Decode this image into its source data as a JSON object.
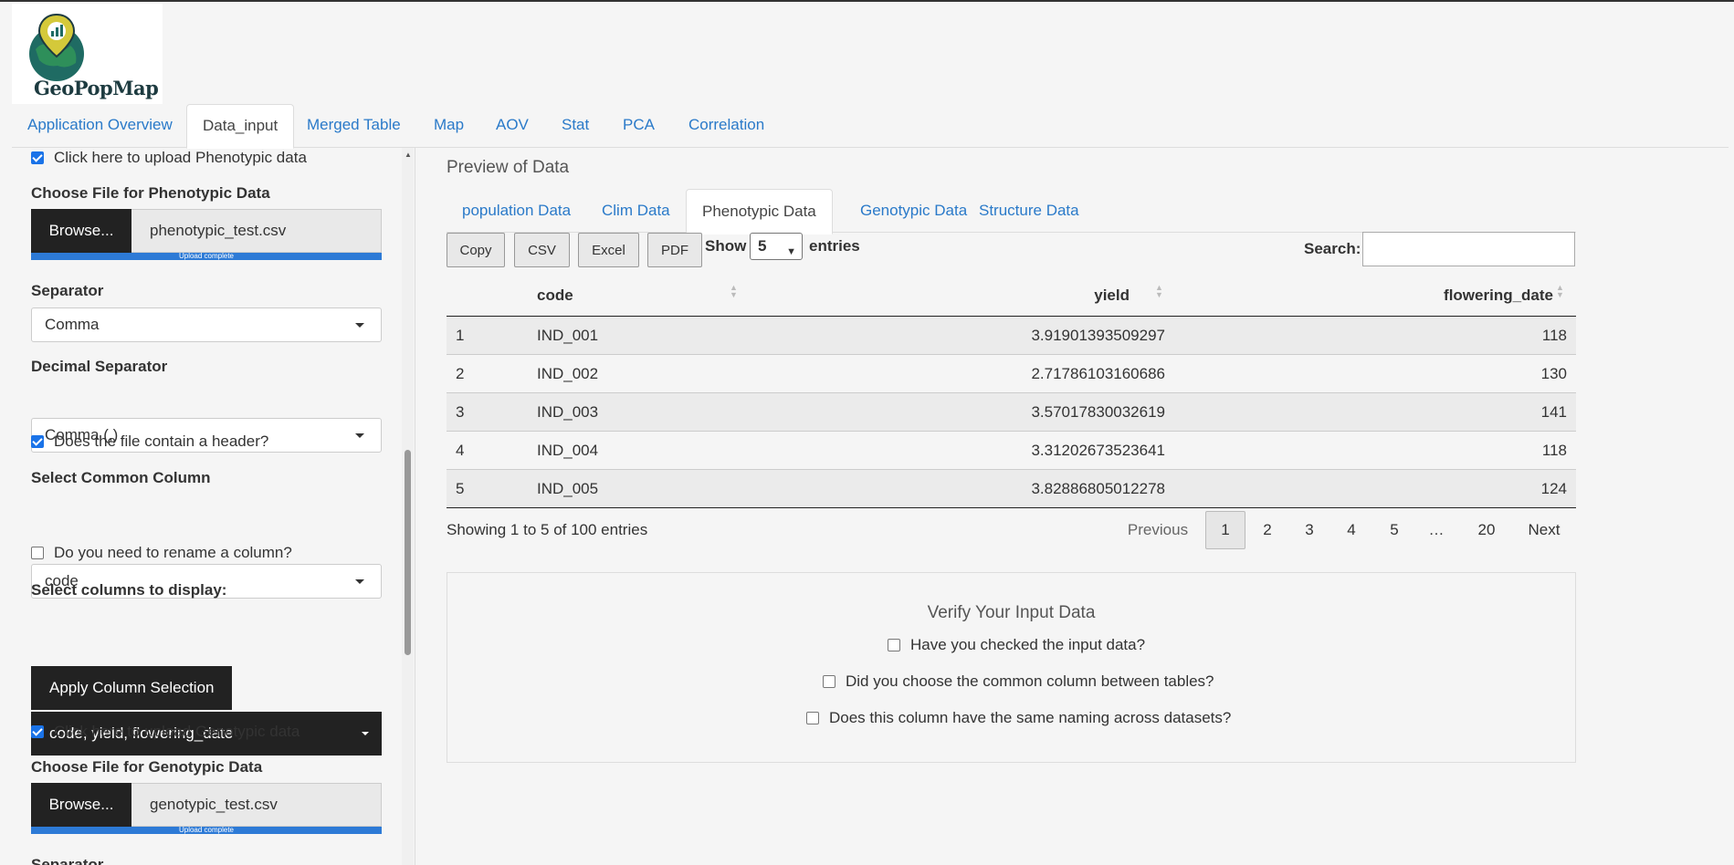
{
  "app": {
    "logo_text": "GeoPopMap"
  },
  "navbar": {
    "tabs": [
      {
        "label": "Application Overview"
      },
      {
        "label": "Data_input",
        "active": true
      },
      {
        "label": "Merged Table"
      },
      {
        "label": "Map"
      },
      {
        "label": "AOV"
      },
      {
        "label": "Stat"
      },
      {
        "label": "PCA"
      },
      {
        "label": "Correlation"
      }
    ]
  },
  "sidebar": {
    "upload_pheno": {
      "label": "Click here to upload Phenotypic data",
      "checked": true
    },
    "pheno_file_label": "Choose File for Phenotypic Data",
    "pheno_browse": "Browse...",
    "pheno_filename": "phenotypic_test.csv",
    "pheno_progress": "Upload complete",
    "separator_label": "Separator",
    "separator_value": "Comma",
    "decimal_label": "Decimal Separator",
    "decimal_value": "Comma (,)",
    "header_check": {
      "label": "Does the file contain a header?",
      "checked": true
    },
    "common_col_label": "Select Common Column",
    "common_col_value": "code",
    "rename_check": {
      "label": "Do you need to rename a column?",
      "checked": false
    },
    "display_cols_label": "Select columns to display:",
    "display_cols_value": "code, yield, flowering_date",
    "apply_button": "Apply Column Selection",
    "upload_geno": {
      "label": "Click here to upload Genotypic data",
      "checked": true
    },
    "geno_file_label": "Choose File for Genotypic Data",
    "geno_browse": "Browse...",
    "geno_filename": "genotypic_test.csv",
    "geno_progress": "Upload complete",
    "separator2_label": "Separator"
  },
  "main": {
    "title": "Preview of Data",
    "subtabs": [
      {
        "label": "population Data"
      },
      {
        "label": "Clim Data"
      },
      {
        "label": "Phenotypic Data",
        "active": true
      },
      {
        "label": "Genotypic Data"
      },
      {
        "label": "Structure Data"
      }
    ],
    "buttons": {
      "copy": "Copy",
      "csv": "CSV",
      "excel": "Excel",
      "pdf": "PDF"
    },
    "show_label": "Show",
    "entries_label": "entries",
    "page_length": "5",
    "search_label": "Search:",
    "search_value": "",
    "table": {
      "headers": [
        "code",
        "yield",
        "flowering_date"
      ],
      "rows": [
        {
          "idx": "1",
          "code": "IND_001",
          "yield": "3.91901393509297",
          "flowering_date": "118"
        },
        {
          "idx": "2",
          "code": "IND_002",
          "yield": "2.71786103160686",
          "flowering_date": "130"
        },
        {
          "idx": "3",
          "code": "IND_003",
          "yield": "3.57017830032619",
          "flowering_date": "141"
        },
        {
          "idx": "4",
          "code": "IND_004",
          "yield": "3.31202673523641",
          "flowering_date": "118"
        },
        {
          "idx": "5",
          "code": "IND_005",
          "yield": "3.82886805012278",
          "flowering_date": "124"
        }
      ]
    },
    "info": "Showing 1 to 5 of 100 entries",
    "pagination": {
      "previous": "Previous",
      "pages": [
        "1",
        "2",
        "3",
        "4",
        "5"
      ],
      "ellipsis": "…",
      "last": "20",
      "next": "Next",
      "current": "1"
    },
    "verify": {
      "title": "Verify Your Input Data",
      "checks": [
        "Have you checked the input data?",
        "Did you choose the common column between tables?",
        "Does this column have the same naming across datasets?"
      ]
    }
  },
  "colors": {
    "accent": "#2a7ac9",
    "dark": "#222222",
    "progress": "#2d7ad6"
  }
}
